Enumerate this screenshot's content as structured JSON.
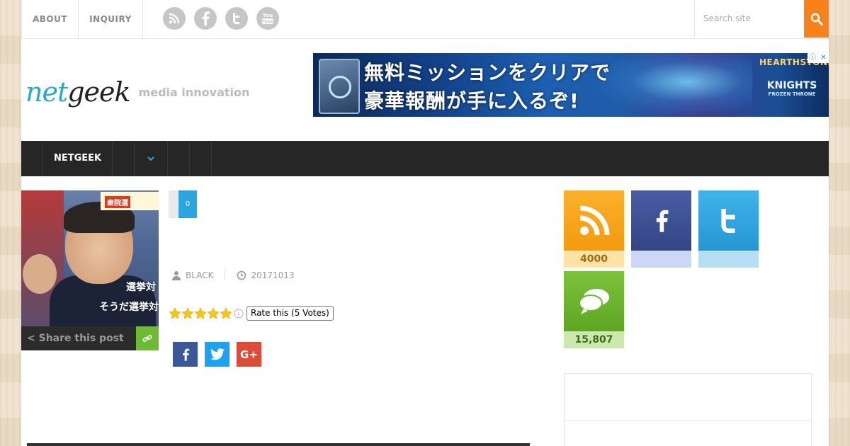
{
  "top_nav": {
    "items": [
      "ABOUT",
      "INQUIRY"
    ],
    "social_icons": [
      "rss-icon",
      "facebook-icon",
      "twitter-icon",
      "youtube-icon"
    ]
  },
  "search": {
    "placeholder": "Search site",
    "icon": "search-icon",
    "button_color": "#f7821b"
  },
  "header": {
    "logo_part1": "net",
    "logo_part2": "geek",
    "tagline": "media innovation",
    "logo_colors": {
      "net": "#2aa7c9",
      "geek": "#222222"
    }
  },
  "ad_banner": {
    "line1": "無料ミッションをクリアで",
    "line2": "豪華報酬が手に入るぞ!",
    "brand": "HEARTHSTONE",
    "subtitle": "KNIGHTS",
    "subtitle2": "FROZEN THRONE",
    "ad_info_icon": "info-icon",
    "ad_close_icon": "close-icon"
  },
  "main_nav": {
    "items": [
      "NETGEEK"
    ],
    "background": "#262626",
    "dropdown_icon": "chevron-down-icon",
    "dropdown_color": "#2ba5e0"
  },
  "post": {
    "thumbnail_caption_top": "選挙対",
    "thumbnail_caption_bottom": "そうだ選挙対",
    "thumbnail_tag": "衆院選",
    "share_label": "Share this post",
    "share_count": "0",
    "author": "BLACK",
    "date": "20171013",
    "rating": {
      "stars": 5,
      "max": 5,
      "tooltip": "Rate this (5 Votes)"
    },
    "share_buttons": [
      {
        "name": "facebook",
        "icon": "facebook-icon",
        "color": "#3b5998"
      },
      {
        "name": "twitter",
        "icon": "twitter-icon",
        "color": "#1da1f2"
      },
      {
        "name": "google-plus",
        "icon": "google-plus-icon",
        "label": "G+",
        "color": "#dd4b39"
      }
    ]
  },
  "sidebar": {
    "widgets": [
      {
        "name": "rss",
        "icon": "rss-icon",
        "count": "4000",
        "color": "#f7a21b"
      },
      {
        "name": "facebook",
        "icon": "facebook-icon",
        "count": "",
        "color": "#3b4f95"
      },
      {
        "name": "twitter",
        "icon": "twitter-icon",
        "count": "",
        "color": "#33a9e4"
      },
      {
        "name": "comments",
        "icon": "comments-icon",
        "count": "15,807",
        "color": "#6db52f"
      }
    ]
  }
}
